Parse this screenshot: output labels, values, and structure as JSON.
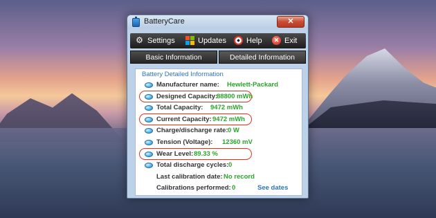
{
  "window": {
    "title": "BatteryCare",
    "close_glyph": "✕"
  },
  "toolbar": {
    "items": [
      {
        "label": "Settings",
        "icon": "gear-icon"
      },
      {
        "label": "Updates",
        "icon": "windows-flag-icon"
      },
      {
        "label": "Help",
        "icon": "lifebuoy-icon"
      },
      {
        "label": "Exit",
        "icon": "exit-icon"
      }
    ]
  },
  "tabs": [
    {
      "label": "Basic Information",
      "selected": false
    },
    {
      "label": "Detailed Information",
      "selected": true
    }
  ],
  "panel": {
    "title": "Battery Detailed Information",
    "rows": [
      {
        "key": "Manufacturer name:",
        "value": "Hewlett-Packard",
        "highlighted": false
      },
      {
        "key": "Designed Capacity:",
        "value": "88800 mWh",
        "highlighted": true
      },
      {
        "key": "Total Capacity:",
        "value": "9472 mWh",
        "highlighted": false
      },
      {
        "key": "Current Capacity:",
        "value": "9472 mWh",
        "highlighted": true
      },
      {
        "key": "Charge/discharge rate:",
        "value": "0 W",
        "highlighted": false
      },
      {
        "key": "Tension (Voltage):",
        "value": "12360 mV",
        "highlighted": false
      },
      {
        "key": "Wear Level:",
        "value": "89.33 %",
        "highlighted": true
      },
      {
        "key": "Total discharge cycles:",
        "value": "0",
        "highlighted": false
      },
      {
        "key": "Last calibration date:",
        "value": "No record",
        "highlighted": false
      },
      {
        "key": "Calibrations performed:",
        "value": "0",
        "highlighted": false
      }
    ],
    "see_dates_link": "See dates"
  },
  "colors": {
    "value_green": "#2aa52a",
    "link_blue": "#2f74c0",
    "highlight_red": "#e0331d",
    "toolbar_dark": "#1d1d1d"
  }
}
